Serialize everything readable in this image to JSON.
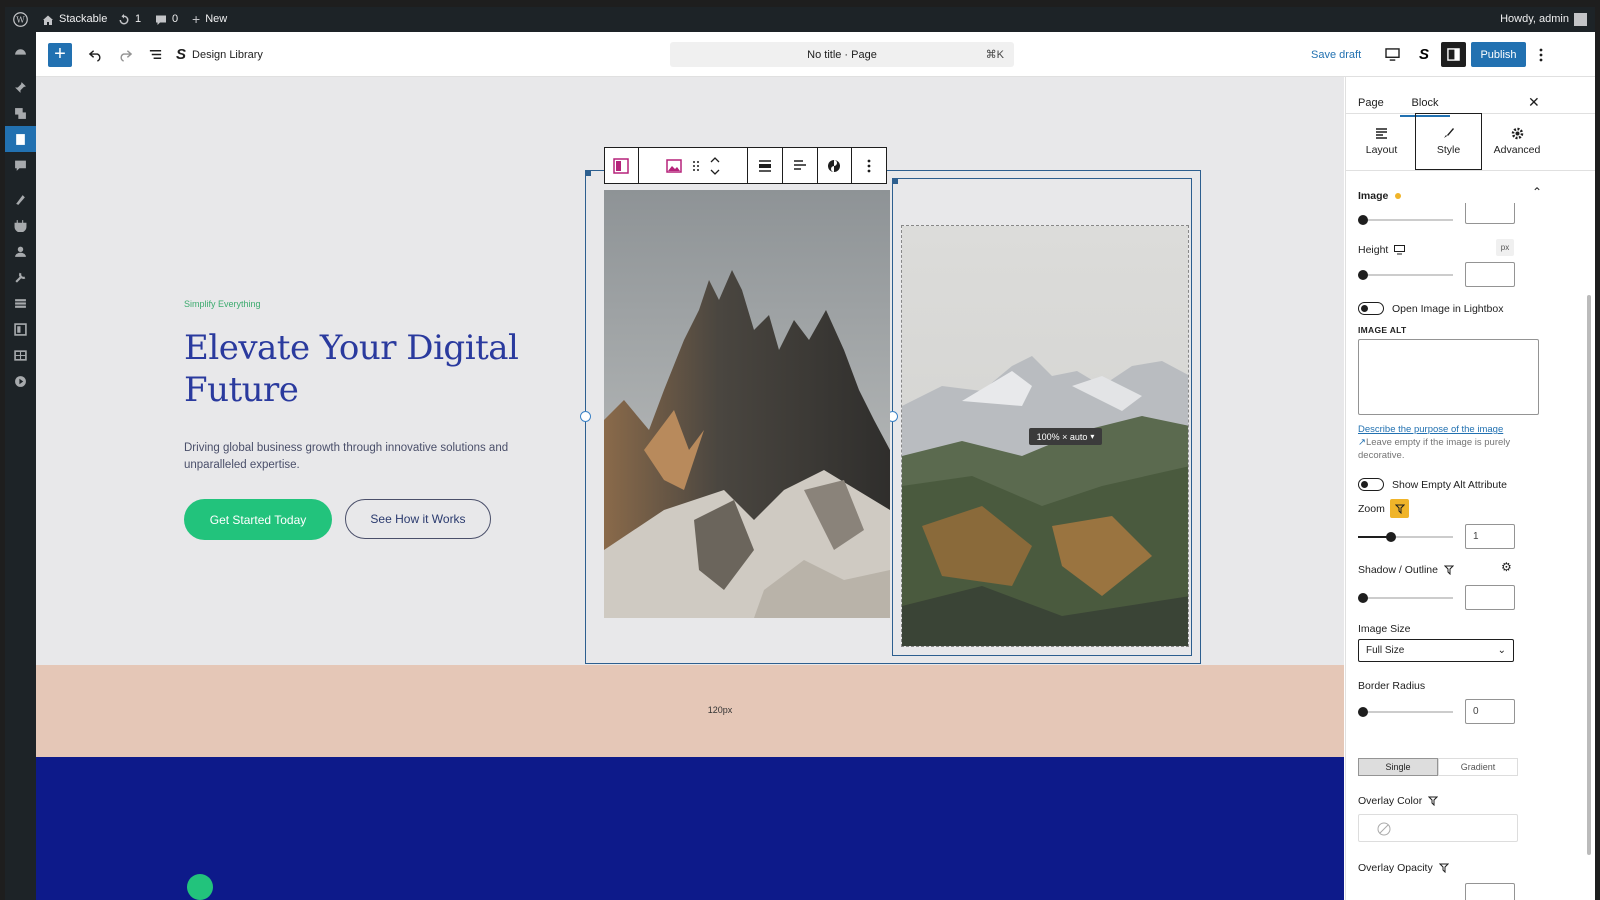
{
  "adminbar": {
    "site_name": "Stackable",
    "updates_count": "1",
    "comments_count": "0",
    "new_label": "New",
    "howdy": "Howdy, admin"
  },
  "toolbar": {
    "design_library": "Design Library",
    "doc_title": "No title · Page",
    "shortcut": "⌘K",
    "save_draft": "Save draft",
    "publish": "Publish",
    "stackable_glyph": "S"
  },
  "hero": {
    "eyebrow": "Simplify Everything",
    "title": "Elevate Your Digital Future",
    "description": "Driving global business growth through innovative solutions and unparalleled expertise.",
    "primary_button": "Get Started Today",
    "secondary_button": "See How it Works"
  },
  "image_block": {
    "size_pill": "100% × auto",
    "spacer_label": "120px"
  },
  "sidebar": {
    "tab_page": "Page",
    "tab_block": "Block",
    "style_tabs": [
      "Layout",
      "Style",
      "Advanced"
    ],
    "panel_title": "Image",
    "height_label": "Height",
    "height_unit": "px",
    "lightbox_label": "Open Image in Lightbox",
    "image_alt_label": "IMAGE ALT",
    "alt_help_link": "Describe the purpose of the image",
    "alt_help_text": "Leave empty if the image is purely decorative.",
    "show_empty_alt": "Show Empty Alt Attribute",
    "zoom_label": "Zoom",
    "zoom_value": "1",
    "shadow_label": "Shadow / Outline",
    "image_size_label": "Image Size",
    "image_size_value": "Full Size",
    "border_radius_label": "Border Radius",
    "border_radius_value": "0",
    "overlay_single": "Single",
    "overlay_gradient": "Gradient",
    "overlay_color_label": "Overlay Color",
    "overlay_opacity_label": "Overlay Opacity",
    "zoom_level": 0.35
  },
  "colors": {
    "admin_bg": "#1d2327",
    "accent_blue": "#2271b1",
    "hero_title": "#2a3a9e",
    "cta_green": "#22c37c",
    "spacer_bg": "#e5c7b7",
    "section_blue": "#0d1a8a",
    "modified_dot": "#f0b429"
  }
}
